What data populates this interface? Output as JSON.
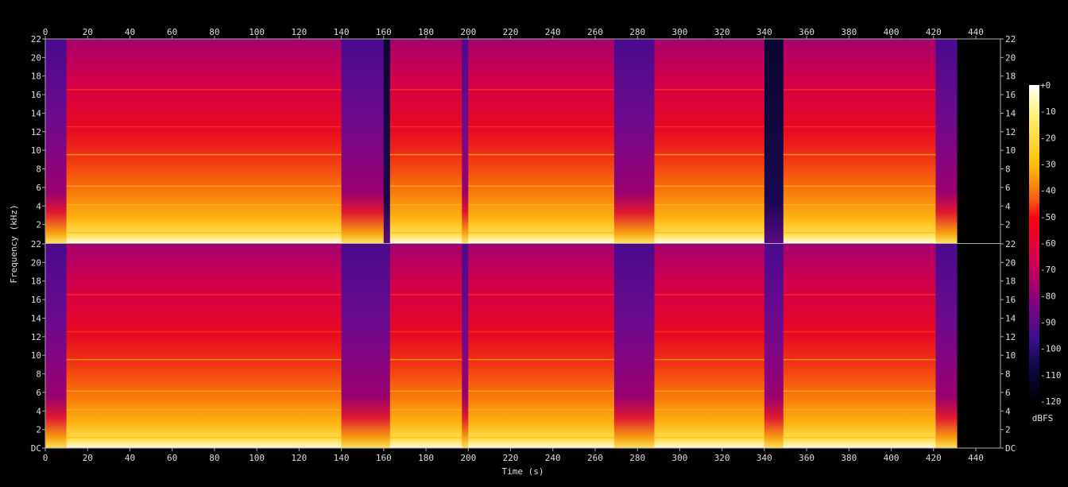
{
  "chart_data": {
    "type": "heatmap",
    "title": "",
    "xlabel": "Time (s)",
    "ylabel": "Frequency (kHz)",
    "xlim": [
      0,
      452
    ],
    "ylim": [
      0,
      22
    ],
    "x_ticks": [
      "0",
      "20",
      "40",
      "60",
      "80",
      "100",
      "120",
      "140",
      "160",
      "180",
      "200",
      "220",
      "240",
      "260",
      "280",
      "300",
      "320",
      "340",
      "360",
      "380",
      "400",
      "420",
      "440"
    ],
    "y_ticks_top": [
      "22",
      "20",
      "18",
      "16",
      "14",
      "12",
      "10",
      "8",
      "6",
      "4",
      "2"
    ],
    "y_ticks_bottom": [
      "22",
      "20",
      "18",
      "16",
      "14",
      "12",
      "10",
      "8",
      "6",
      "4",
      "2",
      "DC"
    ],
    "channels": [
      "top",
      "bottom"
    ],
    "colorbar": {
      "label": "dBFS",
      "ticks": [
        "+0",
        "-10",
        "-20",
        "-30",
        "-40",
        "-50",
        "-60",
        "-70",
        "-80",
        "-90",
        "-100",
        "-110",
        "-120"
      ],
      "range": [
        -120,
        0
      ]
    },
    "audio_end_s": 431,
    "segments_top": [
      {
        "start": 0,
        "end": 10,
        "level": "quiet"
      },
      {
        "start": 10,
        "end": 140,
        "level": "loud"
      },
      {
        "start": 140,
        "end": 160,
        "level": "quiet"
      },
      {
        "start": 160,
        "end": 163,
        "level": "silent"
      },
      {
        "start": 163,
        "end": 197,
        "level": "loud"
      },
      {
        "start": 197,
        "end": 200,
        "level": "quiet"
      },
      {
        "start": 200,
        "end": 269,
        "level": "loud"
      },
      {
        "start": 269,
        "end": 288,
        "level": "quiet"
      },
      {
        "start": 288,
        "end": 340,
        "level": "loud"
      },
      {
        "start": 340,
        "end": 349,
        "level": "silent"
      },
      {
        "start": 349,
        "end": 421,
        "level": "loud"
      },
      {
        "start": 421,
        "end": 431,
        "level": "quiet"
      }
    ],
    "segments_bottom": [
      {
        "start": 0,
        "end": 10,
        "level": "quiet"
      },
      {
        "start": 10,
        "end": 140,
        "level": "loud"
      },
      {
        "start": 140,
        "end": 163,
        "level": "quiet"
      },
      {
        "start": 163,
        "end": 197,
        "level": "loud"
      },
      {
        "start": 197,
        "end": 200,
        "level": "quiet"
      },
      {
        "start": 200,
        "end": 269,
        "level": "loud"
      },
      {
        "start": 269,
        "end": 288,
        "level": "quiet"
      },
      {
        "start": 288,
        "end": 340,
        "level": "loud"
      },
      {
        "start": 340,
        "end": 349,
        "level": "quiet"
      },
      {
        "start": 349,
        "end": 421,
        "level": "loud"
      },
      {
        "start": 421,
        "end": 431,
        "level": "quiet"
      }
    ]
  }
}
